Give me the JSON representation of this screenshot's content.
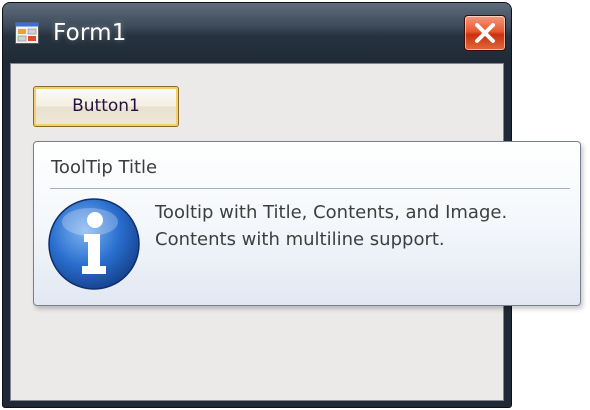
{
  "window": {
    "title": "Form1",
    "app_icon": "form-app-icon",
    "close_icon": "close-icon"
  },
  "form": {
    "button1_label": "Button1"
  },
  "tooltip": {
    "title": "ToolTip Title",
    "icon": "info-icon",
    "lines": [
      "Tooltip with Title, Contents, and Image.",
      "Contents with multiline support."
    ]
  },
  "colors": {
    "titlebar": "#1f2a36",
    "close_button": "#e9582f",
    "client_background": "#ece9e9",
    "button_focus_border": "#f6cf6d",
    "info_icon_blue": "#1f5fb5"
  }
}
